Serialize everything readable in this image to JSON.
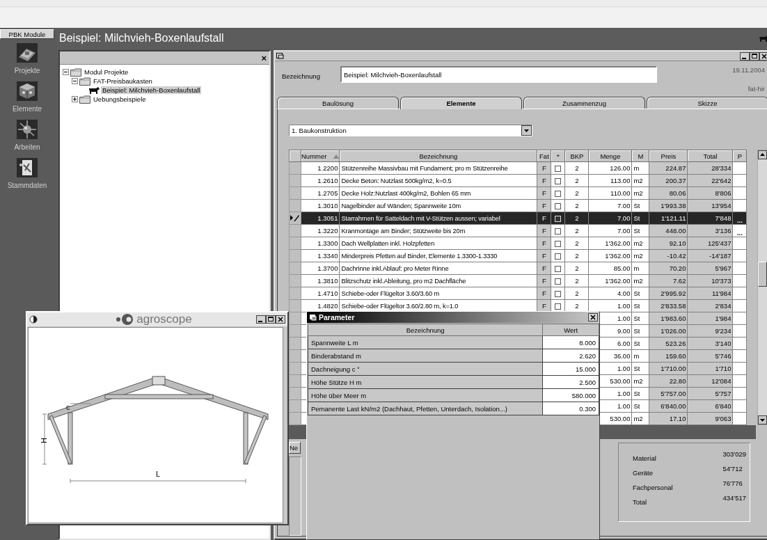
{
  "sidebar": {
    "header": "PBK Module",
    "items": [
      {
        "label": "Projekte",
        "kind": "buildings"
      },
      {
        "label": "Elemente",
        "kind": "cube"
      },
      {
        "label": "Arbeiten",
        "kind": "sphere"
      },
      {
        "label": "Stammdaten",
        "kind": "document"
      }
    ]
  },
  "window": {
    "title": "Beispiel: Milchvieh-Boxenlaufstall"
  },
  "tree": {
    "close_label": "×",
    "items": [
      {
        "label": "Modul Projekte",
        "kind": "folder",
        "expanded": true,
        "selected": false,
        "children": [
          {
            "label": "FAT-Preisbaukasten",
            "kind": "folder",
            "expanded": true,
            "selected": false,
            "children": [
              {
                "label": "Beispiel: Milchvieh-Boxenlaufstall",
                "kind": "project",
                "selected": true
              }
            ]
          },
          {
            "label": "Uebungsbeispiele",
            "kind": "folder",
            "expanded": false,
            "selected": false
          }
        ]
      }
    ]
  },
  "editor": {
    "field_label": "Bezeichnung",
    "field_value": "Beispiel: Milchvieh-Boxenlaufstall",
    "date": "19.11.2004",
    "user": "fat-hir",
    "tabs": [
      {
        "label": "Baulösung",
        "selected": false
      },
      {
        "label": "Elemente",
        "selected": true
      },
      {
        "label": "Zusammenzug",
        "selected": false
      },
      {
        "label": "Skizze",
        "selected": false
      }
    ],
    "dropdown": "1. Baukonstruktion",
    "table": {
      "columns": [
        {
          "label": "Nummer",
          "sorted": true
        },
        {
          "label": "Bezeichnung",
          "sorted": false
        },
        {
          "label": "Fat",
          "sorted": false
        },
        {
          "label": "*",
          "sorted": false
        },
        {
          "label": "BKP",
          "sorted": false
        },
        {
          "label": "Menge",
          "sorted": false
        },
        {
          "label": "M",
          "sorted": false
        },
        {
          "label": "Preis",
          "sorted": false
        },
        {
          "label": "Total",
          "sorted": false
        },
        {
          "label": "P",
          "sorted": false
        }
      ],
      "rows": [
        {
          "nummer": "1.2200",
          "bezeichnung": "Stützenreihe Massivbau mit Fundament; pro m Stützenreihe",
          "fat": "F",
          "checked": false,
          "bkp": "2",
          "menge": "126.00",
          "m": "m",
          "preis": "224.87",
          "total": "28'334",
          "selected": false
        },
        {
          "nummer": "1.2610",
          "bezeichnung": "Decke Beton: Nutzlast 500kg/m2, k=0.5",
          "fat": "F",
          "checked": false,
          "bkp": "2",
          "menge": "113.00",
          "m": "m2",
          "preis": "200.37",
          "total": "22'642",
          "selected": false
        },
        {
          "nummer": "1.2705",
          "bezeichnung": "Decke Holz:Nutzlast 400kg/m2, Bohlen 65 mm",
          "fat": "F",
          "checked": false,
          "bkp": "2",
          "menge": "110.00",
          "m": "m2",
          "preis": "80.06",
          "total": "8'806",
          "selected": false
        },
        {
          "nummer": "1.3010",
          "bezeichnung": "Nagelbinder auf Wänden; Spannweite 10m",
          "fat": "F",
          "checked": false,
          "bkp": "2",
          "menge": "7.00",
          "m": "St",
          "preis": "1'993.38",
          "total": "13'954",
          "selected": false
        },
        {
          "nummer": "1.3051",
          "bezeichnung": "Starrahmen für Satteldach mit V-Stützen aussen; variabel",
          "fat": "F",
          "checked": false,
          "bkp": "2",
          "menge": "7.00",
          "m": "St",
          "preis": "1'121.11",
          "total": "7'848",
          "p": "...",
          "selected": true
        },
        {
          "nummer": "1.3220",
          "bezeichnung": "Kranmontage am Binder; Stützweite bis 20m",
          "fat": "F",
          "checked": false,
          "bkp": "2",
          "menge": "7.00",
          "m": "St",
          "preis": "448.00",
          "total": "3'136",
          "p": "...",
          "selected": false
        },
        {
          "nummer": "1.3300",
          "bezeichnung": "Dach Wellplatten inkl. Holzpfetten",
          "fat": "F",
          "checked": false,
          "bkp": "2",
          "menge": "1'362.00",
          "m": "m2",
          "preis": "92.10",
          "total": "125'437",
          "selected": false
        },
        {
          "nummer": "1.3340",
          "bezeichnung": "Minderpreis Pfetten auf Binder, Elemente 1.3300-1.3330",
          "fat": "F",
          "checked": false,
          "bkp": "2",
          "menge": "1'362.00",
          "m": "m2",
          "preis": "-10.42",
          "total": "-14'187",
          "selected": false
        },
        {
          "nummer": "1.3700",
          "bezeichnung": "Dachrinne inkl.Ablauf: pro Meter Rinne",
          "fat": "F",
          "checked": false,
          "bkp": "2",
          "menge": "85.00",
          "m": "m",
          "preis": "70.20",
          "total": "5'967",
          "selected": false
        },
        {
          "nummer": "1.3810",
          "bezeichnung": "Blitzschutz inkl.Ableitung, pro m2 Dachfläche",
          "fat": "F",
          "checked": false,
          "bkp": "2",
          "menge": "1'362.00",
          "m": "m2",
          "preis": "7.62",
          "total": "10'373",
          "selected": false
        },
        {
          "nummer": "1.4710",
          "bezeichnung": "Schiebe-oder Flügeltor 3.60/3.60 m",
          "fat": "F",
          "checked": false,
          "bkp": "2",
          "menge": "4.00",
          "m": "St",
          "preis": "2'995.92",
          "total": "11'984",
          "selected": false
        },
        {
          "nummer": "1.4820",
          "bezeichnung": "Schiebe-oder Flügeltor 3.60/2.80 m, k=1.0",
          "fat": "F",
          "checked": false,
          "bkp": "2",
          "menge": "1.00",
          "m": "St",
          "preis": "2'833.58",
          "total": "2'834",
          "selected": false
        },
        {
          "menge": "1.00",
          "m": "St",
          "preis": "1'983.60",
          "total": "1'984",
          "selected": false
        },
        {
          "menge": "9.00",
          "m": "St",
          "preis": "1'026.00",
          "total": "9'234",
          "selected": false
        },
        {
          "menge": "6.00",
          "m": "St",
          "preis": "523.26",
          "total": "3'140",
          "selected": false
        },
        {
          "menge": "36.00",
          "m": "m",
          "preis": "159.60",
          "total": "5'746",
          "selected": false
        },
        {
          "menge": "1.00",
          "m": "St",
          "preis": "1'710.00",
          "total": "1'710",
          "selected": false
        },
        {
          "menge": "530.00",
          "m": "m2",
          "preis": "22.80",
          "total": "12'084",
          "selected": false
        },
        {
          "menge": "1.00",
          "m": "St",
          "preis": "5'757.00",
          "total": "5'757",
          "selected": false
        },
        {
          "menge": "1.00",
          "m": "St",
          "preis": "6'840.00",
          "total": "6'840",
          "selected": false
        },
        {
          "menge": "530.00",
          "m": "m2",
          "preis": "17.10",
          "total": "9'063",
          "selected": false
        }
      ]
    },
    "button": "Ne",
    "summary": [
      {
        "label": "Material",
        "value": "303'029"
      },
      {
        "label": "Geräte",
        "value": "54'712"
      },
      {
        "label": "Fachpersonal",
        "value": "76'776"
      },
      {
        "label": "Total",
        "value": "434'517"
      }
    ]
  },
  "parameter_dialog": {
    "title": "Parameter",
    "columns": [
      "Bezeichnung",
      "Wert"
    ],
    "rows": [
      {
        "label": "Spannweite L  m",
        "value": "8.000"
      },
      {
        "label": "Binderabstand  m",
        "value": "2.620"
      },
      {
        "label": "Dachneigung  c °",
        "value": "15.000"
      },
      {
        "label": "Höhe Stütze  H  m",
        "value": "2.500"
      },
      {
        "label": "Höhe über Meer  m",
        "value": "580.000"
      },
      {
        "label": "Pemanente Last kN/m2 (Dachhaut, Pfetten, Unterdach, Isolation...)",
        "value": "0.300"
      }
    ]
  },
  "sketch_window": {
    "logo": "agroscope",
    "angle_label": "c",
    "height_label": "H",
    "span_label": "L"
  }
}
